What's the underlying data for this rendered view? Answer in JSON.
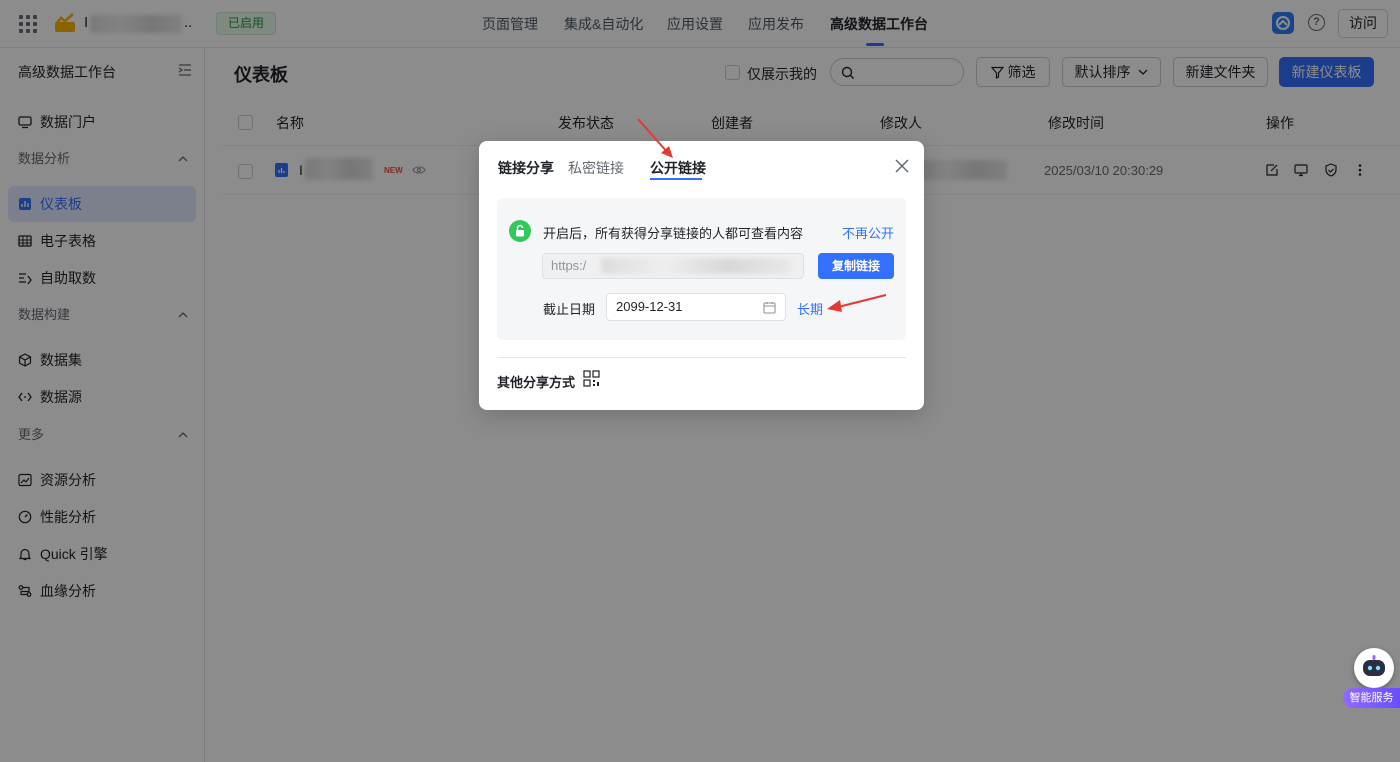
{
  "topbar": {
    "app_name": "I",
    "app_suffix": "..",
    "status": "已启用",
    "nav": [
      "页面管理",
      "集成&自动化",
      "应用设置",
      "应用发布",
      "高级数据工作台"
    ],
    "help_glyph": "?",
    "visit": "访问"
  },
  "sidebar": {
    "title": "高级数据工作台",
    "items": {
      "portal": "数据门户",
      "group_analysis": "数据分析",
      "dashboard": "仪表板",
      "spreadsheet": "电子表格",
      "self_service": "自助取数",
      "group_build": "数据构建",
      "dataset": "数据集",
      "datasource": "数据源",
      "group_more": "更多",
      "resource": "资源分析",
      "performance": "性能分析",
      "quick": "Quick 引擎",
      "lineage": "血缘分析"
    }
  },
  "main": {
    "title": "仪表板",
    "only_mine": "仅展示我的",
    "filter": "筛选",
    "sort": "默认排序",
    "new_folder": "新建文件夹",
    "new_dashboard": "新建仪表板",
    "columns": {
      "name": "名称",
      "status": "发布状态",
      "creator": "创建者",
      "modifier": "修改人",
      "modified_time": "修改时间",
      "actions": "操作"
    },
    "row": {
      "name": "I",
      "badge": "NEW",
      "modified_time": "2025/03/10 20:30:29"
    }
  },
  "modal": {
    "tabs": {
      "share": "链接分享",
      "private": "私密链接",
      "public": "公开链接"
    },
    "notice": "开启后，所有获得分享链接的人都可查看内容",
    "unpublish": "不再公开",
    "url": "https:/",
    "copy": "复制链接",
    "expiry_label": "截止日期",
    "expiry_date": "2099-12-31",
    "long_term": "长期",
    "other_share": "其他分享方式"
  },
  "assistant": {
    "label": "智能服务"
  },
  "colors": {
    "primary": "#3370ff",
    "success": "#34c759",
    "annotation": "#e53935"
  }
}
